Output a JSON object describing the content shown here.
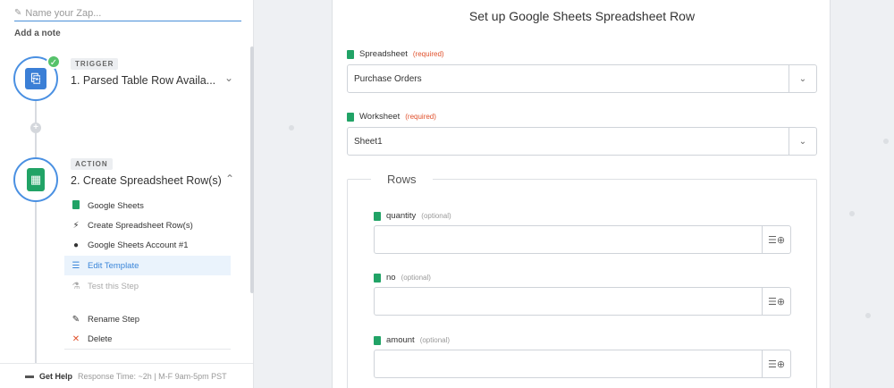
{
  "sidebar": {
    "zap_name_placeholder": "Name your Zap...",
    "add_note": "Add a note",
    "trigger": {
      "tag": "TRIGGER",
      "title": "1. Parsed Table Row Availa..."
    },
    "action": {
      "tag": "ACTION",
      "title": "2. Create Spreadsheet Row(s)",
      "items": [
        {
          "label": "Google Sheets",
          "icon": "google-sheets-icon"
        },
        {
          "label": "Create Spreadsheet Row(s)",
          "icon": "bolt-icon"
        },
        {
          "label": "Google Sheets Account #1",
          "icon": "user-icon"
        },
        {
          "label": "Edit Template",
          "icon": "lines-icon"
        },
        {
          "label": "Test this Step",
          "icon": "flask-icon"
        }
      ],
      "rename": "Rename Step",
      "delete": "Delete"
    },
    "help": {
      "label": "Get Help",
      "meta": "Response Time: ~2h | M-F 9am-5pm PST"
    }
  },
  "main": {
    "title": "Set up Google Sheets Spreadsheet Row",
    "spreadsheet": {
      "label": "Spreadsheet",
      "req": "(required)",
      "value": "Purchase Orders"
    },
    "worksheet": {
      "label": "Worksheet",
      "req": "(required)",
      "value": "Sheet1"
    },
    "rows": {
      "legend": "Rows",
      "fields": [
        {
          "label": "quantity",
          "opt": "(optional)"
        },
        {
          "label": "no",
          "opt": "(optional)"
        },
        {
          "label": "amount",
          "opt": "(optional)"
        }
      ]
    }
  },
  "colors": {
    "accent": "#4a90e2",
    "sheets_green": "#21a366",
    "required": "#e0502b",
    "check": "#56c26b"
  }
}
